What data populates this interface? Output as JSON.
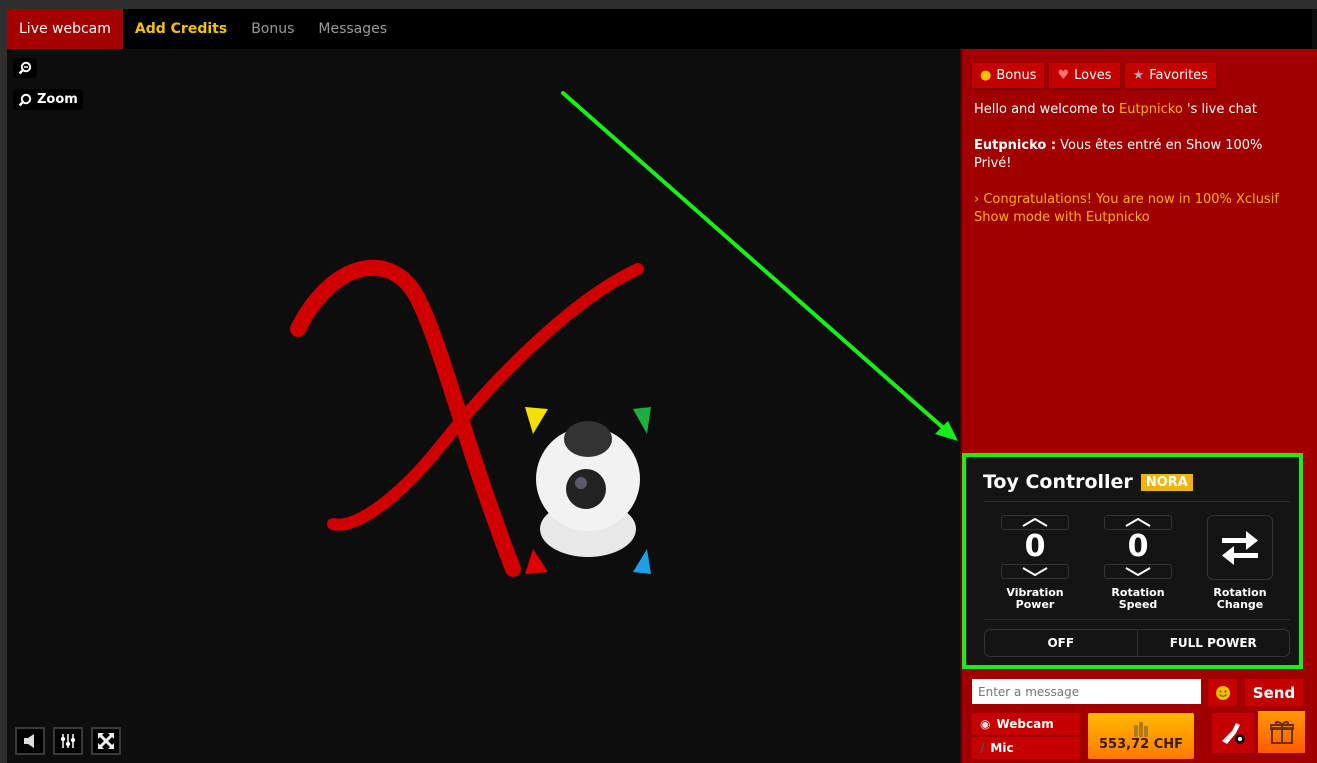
{
  "nav": {
    "tabs": [
      {
        "label": "Live webcam",
        "active": true
      },
      {
        "label": "Add Credits"
      },
      {
        "label": "Bonus"
      },
      {
        "label": "Messages"
      }
    ]
  },
  "video": {
    "zoom_label": "Zoom",
    "controls": [
      "volume-icon",
      "equalizer-icon",
      "fullscreen-icon"
    ]
  },
  "sidebar": {
    "buttons": [
      {
        "label": "Bonus",
        "icon": "coins-icon"
      },
      {
        "label": "Loves",
        "icon": "heart-icon"
      },
      {
        "label": "Favorites",
        "icon": "star-icon"
      }
    ],
    "chat": {
      "welcome_prefix": "Hello and welcome to ",
      "welcome_name": "Eutpnicko",
      "welcome_suffix": " 's live chat",
      "msg_author": "Eutpnicko :",
      "msg_text": " Vous êtes entré en Show 100% Privé!",
      "system_msg": "› Congratulations! You are now in 100% Xclusif Show mode with Eutpnicko"
    }
  },
  "toy_controller": {
    "title": "Toy Controller",
    "badge": "NORA",
    "vibration_power": "0",
    "vibration_label_1": "Vibration",
    "vibration_label_2": "Power",
    "rotation_speed": "0",
    "rotation_label_1": "Rotation",
    "rotation_label_2": "Speed",
    "change_label_1": "Rotation",
    "change_label_2": "Change",
    "off_label": "OFF",
    "full_power_label": "FULL POWER"
  },
  "composer": {
    "placeholder": "Enter a message",
    "send_label": "Send",
    "webcam_label": "Webcam",
    "mic_label": "Mic",
    "balance": "553,72 CHF"
  },
  "colors": {
    "brand_red": "#a00000",
    "accent_yellow": "#f8b400",
    "annotation_green": "#16f016"
  }
}
